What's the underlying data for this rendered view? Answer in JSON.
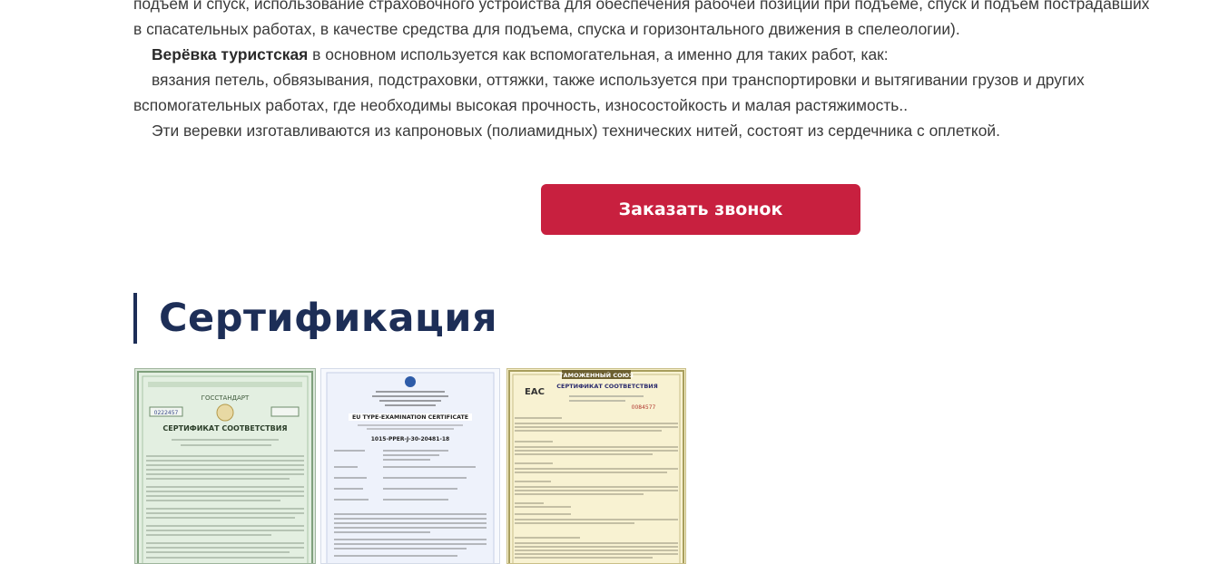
{
  "article": {
    "line1": "подъем и спуск, использование страховочного устройства для обеспечения рабочей позиции при подъеме, спуск и подъем пострадавших",
    "line2": "в спасательных работах, в качестве средства для подъема, спуска и горизонтального движения в спелеологии).",
    "line3_bold": "Верёвка туристская",
    "line3_rest": " в основном используется как вспомогательная, а именно для таких работ, как:",
    "line4": "вязания петель, обвязывания, подстраховки, оттяжки, также используется при транспортировки и вытягивании грузов и других",
    "line5": "вспомогательных работах, где необходимы высокая прочность, износостойкость и малая растяжимость..",
    "line6": "Эти веревки изготавливаются из капроновых (полиамидных) технических нитей, состоят из сердечника с оплеткой."
  },
  "cta": {
    "label": "Заказать звонок"
  },
  "certification": {
    "title": "Сертификация",
    "items": [
      {
        "heading": "СЕРТИФИКАТ СООТВЕТСТВИЯ",
        "org": "ГОССТАНДАРТ",
        "number": "0222457"
      },
      {
        "heading": "EU TYPE-EXAMINATION CERTIFICATE",
        "number": "1015-PPER-J-30-20481-18"
      },
      {
        "banner": "ТАМОЖЕННЫЙ СОЮЗ",
        "heading": "СЕРТИФИКАТ СООТВЕТСТВИЯ",
        "mark": "EAC",
        "number": "0084577"
      }
    ]
  },
  "colors": {
    "accent": "#c8203f",
    "title": "#1d2e57",
    "text": "#3a3a3a"
  }
}
